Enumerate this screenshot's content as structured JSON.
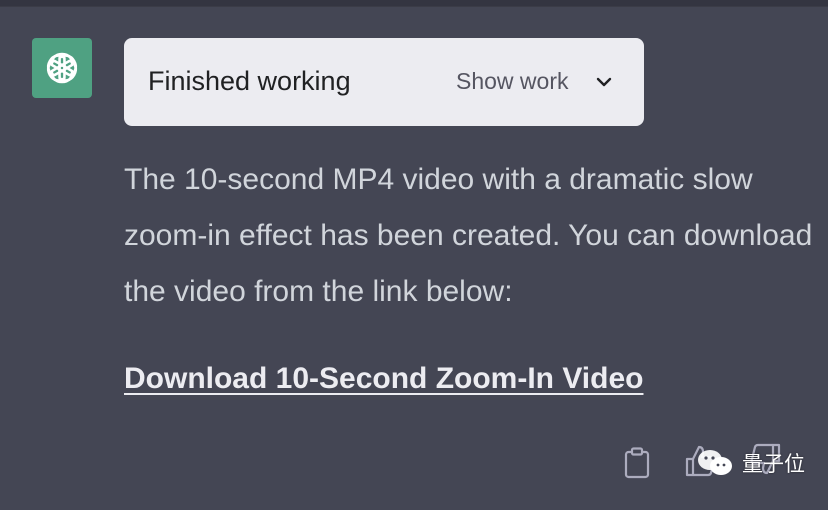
{
  "assistant": {
    "avatar_icon": "openai-logo-icon",
    "avatar_color": "#4fa182"
  },
  "work_card": {
    "status": "Finished working",
    "toggle_label": "Show work",
    "toggle_icon": "chevron-down-icon"
  },
  "message": {
    "text": "The 10-second MP4 video with a dramatic slow zoom-in effect has been created. You can download the video from the link below:",
    "link_text": "Download 10-Second Zoom-In Video"
  },
  "actions": {
    "copy_icon": "clipboard-icon",
    "like_icon": "thumbs-up-icon",
    "dislike_icon": "thumbs-down-icon"
  },
  "watermark": {
    "text": "量子位",
    "icon": "wechat-icon"
  }
}
